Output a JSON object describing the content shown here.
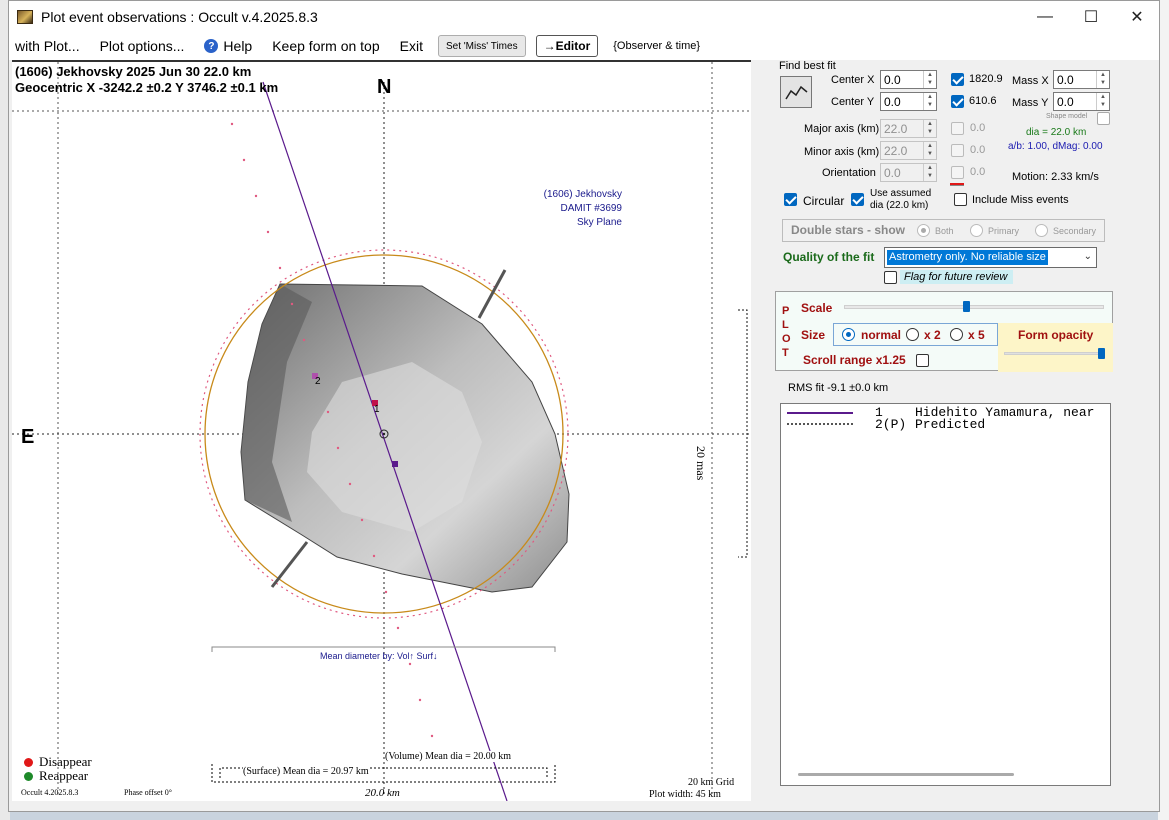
{
  "window": {
    "title": "Plot event observations : Occult v.4.2025.8.3",
    "minimize": "—",
    "maximize": "☐",
    "close": "✕"
  },
  "menu": {
    "with_plot": "with Plot...",
    "plot_options": "Plot options...",
    "help": "Help",
    "keep_on_top": "Keep form on top",
    "exit": "Exit",
    "set_miss_times": "Set 'Miss' Times",
    "editor": "→Editor",
    "observer_time": "{Observer & time}"
  },
  "plot": {
    "header_line1": "(1606) Jekhovsky  2025 Jun 30   22.0 km",
    "header_line2": "Geocentric  X  -3242.2 ±0.2  Y 3746.2 ±0.1 km",
    "north": "N",
    "east": "E",
    "model_label1": "(1606) Jekhovsky",
    "model_label2": "DAMIT #3699",
    "model_label3": "Sky Plane",
    "scale_label": "20 mas",
    "mean_diam_by": "Mean diameter by: Vol↑  Surf↓",
    "chord1": "1",
    "chord2": "2",
    "volume_dia": "(Volume) Mean dia = 20.00 km",
    "surface_dia": "(Surface) Mean dia = 20.97 km",
    "scale_bar": "20.0 km",
    "grid": "20 km Grid",
    "plot_width": "Plot width: 45 km",
    "version": "Occult 4.2025.8.3",
    "phase_offset": "Phase offset 0°",
    "disappear": "Disappear",
    "reappear": "Reappear",
    "disappear_color": "#e01818",
    "reappear_color": "#1e8a2a",
    "observed_chord_color": "#5a1a8c",
    "limb_circle_color": "#c88a1a",
    "predicted_color": "#e05a80"
  },
  "fit": {
    "find_best_fit": "Find best fit",
    "center_x_label": "Center X",
    "center_x": "0.0",
    "center_y_label": "Center Y",
    "center_y": "0.0",
    "mass_x_check": "1820.9",
    "mass_x_label": "Mass X",
    "mass_x": "0.0",
    "mass_y_check": "610.6",
    "mass_y_label": "Mass Y",
    "mass_y": "0.0",
    "shape_model": "Shape model",
    "major_axis_label": "Major axis (km)",
    "major_axis": "22.0",
    "major_axis_check": "0.0",
    "dia": "dia = 22.0 km",
    "minor_axis_label": "Minor axis (km)",
    "minor_axis": "22.0",
    "minor_axis_check": "0.0",
    "ab_dmag": "a/b: 1.00, dMag: 0.00",
    "orientation_label": "Orientation",
    "orientation": "0.0",
    "orientation_check": "0.0",
    "motion": "Motion: 2.33 km/s",
    "circular": "Circular",
    "use_assumed": "Use assumed",
    "use_assumed2": "dia (22.0 km)",
    "include_miss": "Include Miss events",
    "double_stars": "Double stars - show",
    "both": "Both",
    "primary": "Primary",
    "secondary": "Secondary",
    "quality_label": "Quality of the fit",
    "quality_value": "Astrometry only. No reliable size",
    "flag_review": "Flag for future review"
  },
  "plotpanel": {
    "vertical": "PLOT",
    "scale": "Scale",
    "size": "Size",
    "normal": "normal",
    "x2": "x 2",
    "x5": "x 5",
    "form_opacity": "Form opacity",
    "scroll_range": "Scroll range x1.25"
  },
  "rms": "RMS fit -9.1 ±0.0 km",
  "legend": {
    "row1_num": "1",
    "row1_name": "Hidehito Yamamura, near",
    "row2_num": "2(P)",
    "row2_name": "Predicted"
  }
}
